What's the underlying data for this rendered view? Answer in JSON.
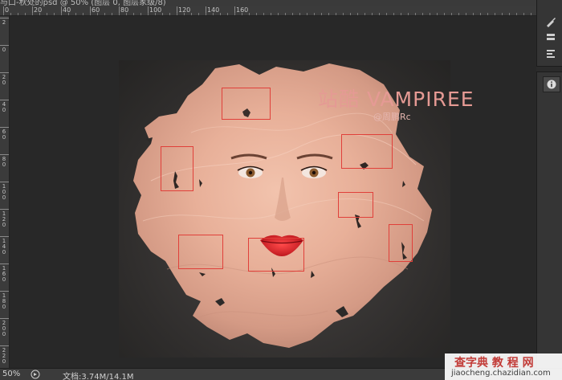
{
  "document_tab": {
    "title": "与口-秋处的psd @ 50% (图层 0, 图层家级/8)"
  },
  "ruler": {
    "horizontal_labels": [
      "0",
      "20",
      "40",
      "60",
      "80",
      "100",
      "120",
      "140",
      "160"
    ],
    "vertical_labels": [
      "2",
      "0",
      "2 0",
      "4 0",
      "6 0",
      "8 0",
      "1 0 0",
      "1 2 0",
      "1 4 0",
      "1 6 0",
      "1 8 0",
      "2 0 0",
      "2 2 0"
    ]
  },
  "canvas": {
    "title_text": "站酷 VAMPIREE",
    "credit_text": "@周鹏Rc",
    "title_color": "#e59a94",
    "selection_color": "#e0403a",
    "selection_count": 8
  },
  "right_panel": {
    "icons": [
      "brush-icon",
      "layers-icon",
      "paragraph-icon",
      "info-icon"
    ]
  },
  "status_bar": {
    "zoom": "50%",
    "doc_info": "文档:3.74M/14.1M"
  },
  "watermark": {
    "line1": "查字典 教 程 网",
    "line2": "jiaocheng.chazidian.com"
  }
}
